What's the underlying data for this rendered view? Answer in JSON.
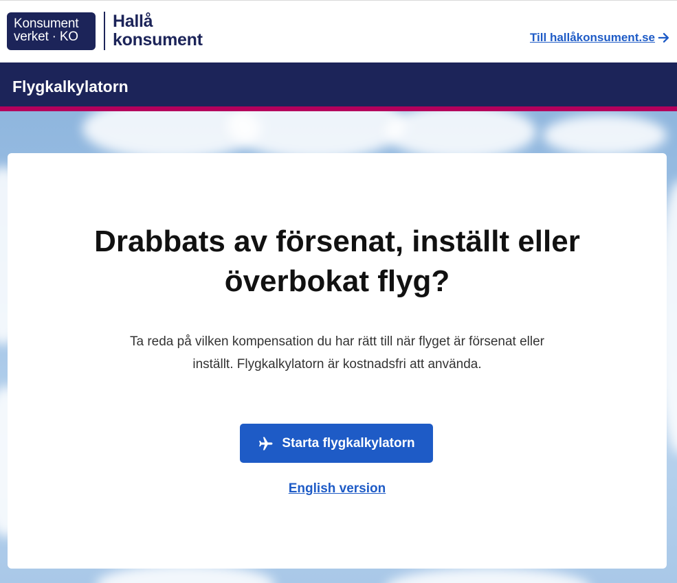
{
  "header": {
    "logo_kv_line1": "Konsument",
    "logo_kv_line2": "verket · KO",
    "logo_halla_line1": "Hallå",
    "logo_halla_line2": "konsument",
    "external_link_label": "Till hallåkonsument.se",
    "external_link_icon": "arrow-right-icon"
  },
  "nav": {
    "title": "Flygkalkylatorn"
  },
  "main": {
    "headline_line1": "Drabbats av försenat, inställt eller",
    "headline_line2": "överbokat flyg?",
    "intro_line1": "Ta reda på vilken kompensation du har rätt till när flyget är försenat eller",
    "intro_line2": "inställt. Flygkalkylatorn är kostnadsfri att använda.",
    "start_button_label": "Starta flygkalkylatorn",
    "start_button_icon": "airplane-icon",
    "english_link_label": "English version"
  },
  "colors": {
    "brand_navy": "#1c2459",
    "accent_magenta": "#b4005c",
    "link_blue": "#1e5bc6"
  }
}
